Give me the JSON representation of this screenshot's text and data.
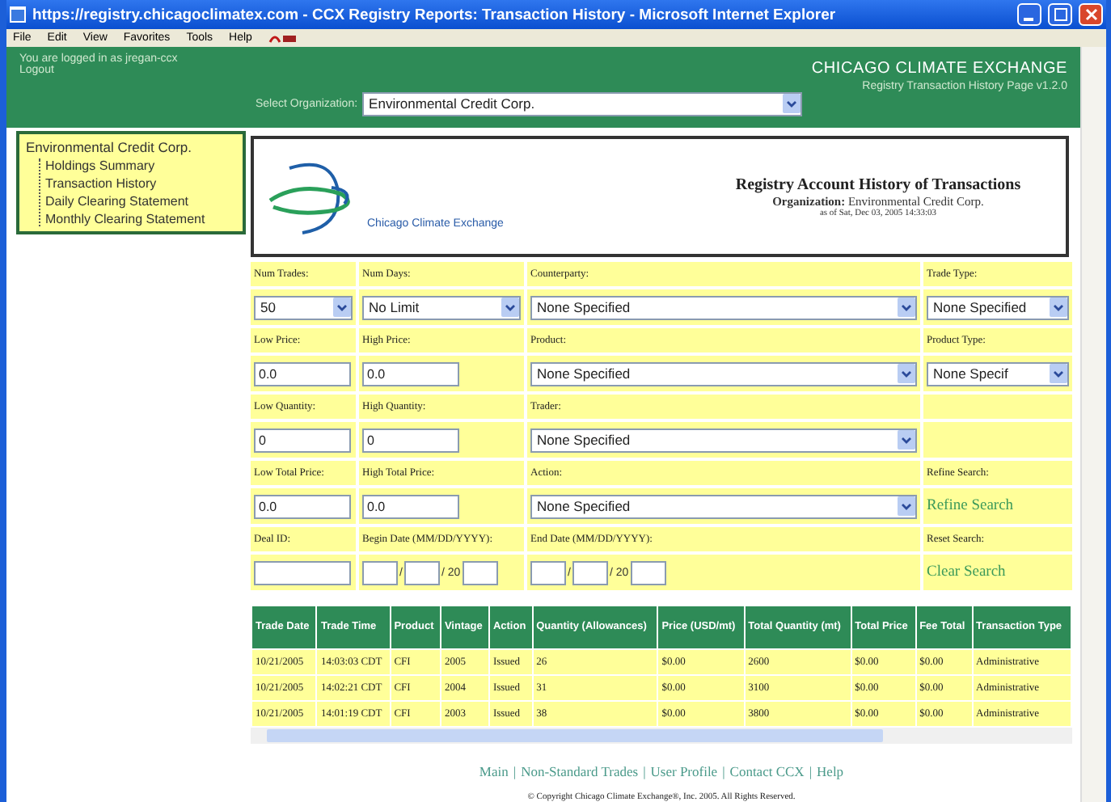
{
  "window": {
    "title": "https://registry.chicagoclimatex.com - CCX Registry Reports: Transaction History - Microsoft Internet Explorer"
  },
  "menu": [
    "File",
    "Edit",
    "View",
    "Favorites",
    "Tools",
    "Help"
  ],
  "header": {
    "login": "You are logged in as jregan-ccx",
    "logout": "Logout",
    "org_label": "Select Organization:",
    "org_value": "Environmental Credit Corp.",
    "brand": "CHICAGO CLIMATE EXCHANGE",
    "subtitle": "Registry Transaction History Page v1.2.0"
  },
  "sidebar": {
    "title": "Environmental Credit Corp.",
    "children": [
      {
        "label": "Holdings Summary"
      },
      {
        "label": "Transaction History"
      },
      {
        "label": "Daily Clearing Statement"
      },
      {
        "label": "Monthly Clearing Statement"
      }
    ]
  },
  "report": {
    "logo_text": "Chicago Climate Exchange",
    "title": "Registry Account History of Transactions",
    "organization": "**Organization:** Environmental Credit Corp.",
    "as_of": "as of Sat, Dec 03, 2005 14:33:03"
  },
  "form": [
    [
      {
        "label": "Num Trades:",
        "kind": "select",
        "value": "50"
      },
      {
        "label": "Num Days:",
        "kind": "select",
        "value": "No Limit"
      },
      {
        "label": "Counterparty:",
        "kind": "select",
        "value": "None Specified"
      },
      {
        "label": "Trade Type:",
        "kind": "select",
        "value": "None Specified"
      }
    ],
    [
      {
        "label": "Low Price:",
        "kind": "text",
        "value": "0.0"
      },
      {
        "label": "High Price:",
        "kind": "text",
        "value": "0.0"
      },
      {
        "label": "Product:",
        "kind": "select",
        "value": "None Specified"
      },
      {
        "label": "Product Type:",
        "kind": "select",
        "value": "None Specif"
      }
    ],
    [
      {
        "label": "Low Quantity:",
        "kind": "text",
        "value": "0"
      },
      {
        "label": "High Quantity:",
        "kind": "text",
        "value": "0"
      },
      {
        "label": "Trader:",
        "kind": "select",
        "value": "None Specified"
      }
    ],
    [
      {
        "label": "Low Total Price:",
        "kind": "text",
        "value": "0.0"
      },
      {
        "label": "High Total Price:",
        "kind": "text",
        "value": "0.0"
      },
      {
        "label": "Action:",
        "kind": "select",
        "value": "None Specified"
      },
      {
        "label": "Refine Search:",
        "kind": "link",
        "value": "Refine Search"
      }
    ],
    [
      {
        "label": "Deal ID:",
        "kind": "text"
      },
      {
        "label": "Begin Date (MM/DD/YYYY):",
        "kind": "date",
        "separators": [
          "/",
          "/ 20"
        ]
      },
      {
        "label": "End Date (MM/DD/YYYY):",
        "kind": "date",
        "separators": [
          "/",
          "/ 20"
        ]
      },
      {
        "label": "Reset Search:",
        "kind": "link",
        "value": "Clear Search"
      }
    ]
  ],
  "table": {
    "columns": [
      "Trade Date",
      "Trade Time",
      "Product",
      "Vintage",
      "Action",
      "Quantity (Allowances)",
      "Price (USD/mt)",
      "Total Quantity (mt)",
      "Total Price",
      "Fee Total",
      "Transaction Type"
    ],
    "rows": [
      [
        "10/21/2005",
        "14:03:03 CDT",
        "CFI",
        "2005",
        "Issued",
        "26",
        "$0.00",
        "2600",
        "$0.00",
        "$0.00",
        "Administrative"
      ],
      [
        "10/21/2005",
        "14:02:21 CDT",
        "CFI",
        "2004",
        "Issued",
        "31",
        "$0.00",
        "3100",
        "$0.00",
        "$0.00",
        "Administrative"
      ],
      [
        "10/21/2005",
        "14:01:19 CDT",
        "CFI",
        "2003",
        "Issued",
        "38",
        "$0.00",
        "3800",
        "$0.00",
        "$0.00",
        "Administrative"
      ]
    ]
  },
  "footer": {
    "links": [
      "Main",
      "Non-Standard Trades",
      "User Profile",
      "Contact CCX",
      "Help"
    ],
    "separator": "|",
    "copyright": "© Copyright Chicago Climate Exchange®, Inc. 2005. All Rights Reserved."
  }
}
